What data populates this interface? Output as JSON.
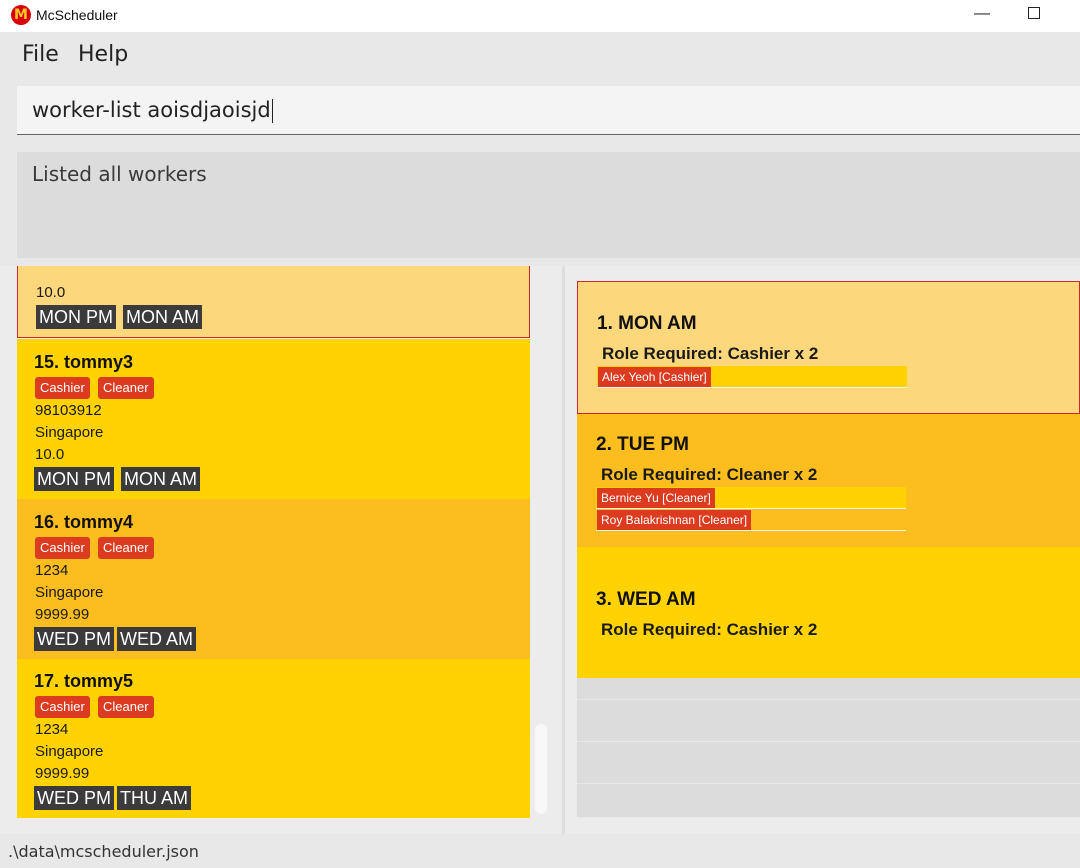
{
  "window": {
    "title": "McScheduler",
    "logo_glyph": "M",
    "minimize_glyph": "—"
  },
  "menu": {
    "file": "File",
    "help": "Help"
  },
  "command": {
    "value": "worker-list aoisdjaoisjd"
  },
  "result": {
    "message": "Listed all workers"
  },
  "workers": [
    {
      "pay": "10.0",
      "availability": [
        "MON PM",
        "MON AM"
      ]
    },
    {
      "name": "15.  tommy3",
      "roles": [
        "Cashier",
        "Cleaner"
      ],
      "phone": "98103912",
      "address": "Singapore",
      "pay": "10.0",
      "availability": [
        "MON PM",
        "MON AM"
      ]
    },
    {
      "name": "16.  tommy4",
      "roles": [
        "Cashier",
        "Cleaner"
      ],
      "phone": "1234",
      "address": "Singapore",
      "pay": "9999.99",
      "availability": [
        "WED PM",
        "WED AM"
      ]
    },
    {
      "name": "17.  tommy5",
      "roles": [
        "Cashier",
        "Cleaner"
      ],
      "phone": "1234",
      "address": "Singapore",
      "pay": "9999.99",
      "availability": [
        "WED PM",
        "THU AM"
      ]
    }
  ],
  "shifts": [
    {
      "title": "1.  MON AM",
      "role_required": "Role Required: Cashier x 2",
      "assignments": [
        "Alex Yeoh [Cashier]"
      ]
    },
    {
      "title": "2.  TUE PM",
      "role_required": "Role Required: Cleaner x 2",
      "assignments": [
        "Bernice Yu [Cleaner]",
        "Roy Balakrishnan [Cleaner]"
      ]
    },
    {
      "title": "3.  WED AM",
      "role_required": "Role Required: Cashier x 2",
      "assignments": []
    }
  ],
  "status": {
    "path": ".\\data\\mcscheduler.json"
  },
  "colors": {
    "card_selected": "#fdd77c",
    "card_yellow": "#ffd200",
    "card_orange": "#fcbd1f",
    "role_tag": "#dc3b1f",
    "availability_tag": "#3b3b3b",
    "selection_border": "#cc2a2a"
  }
}
